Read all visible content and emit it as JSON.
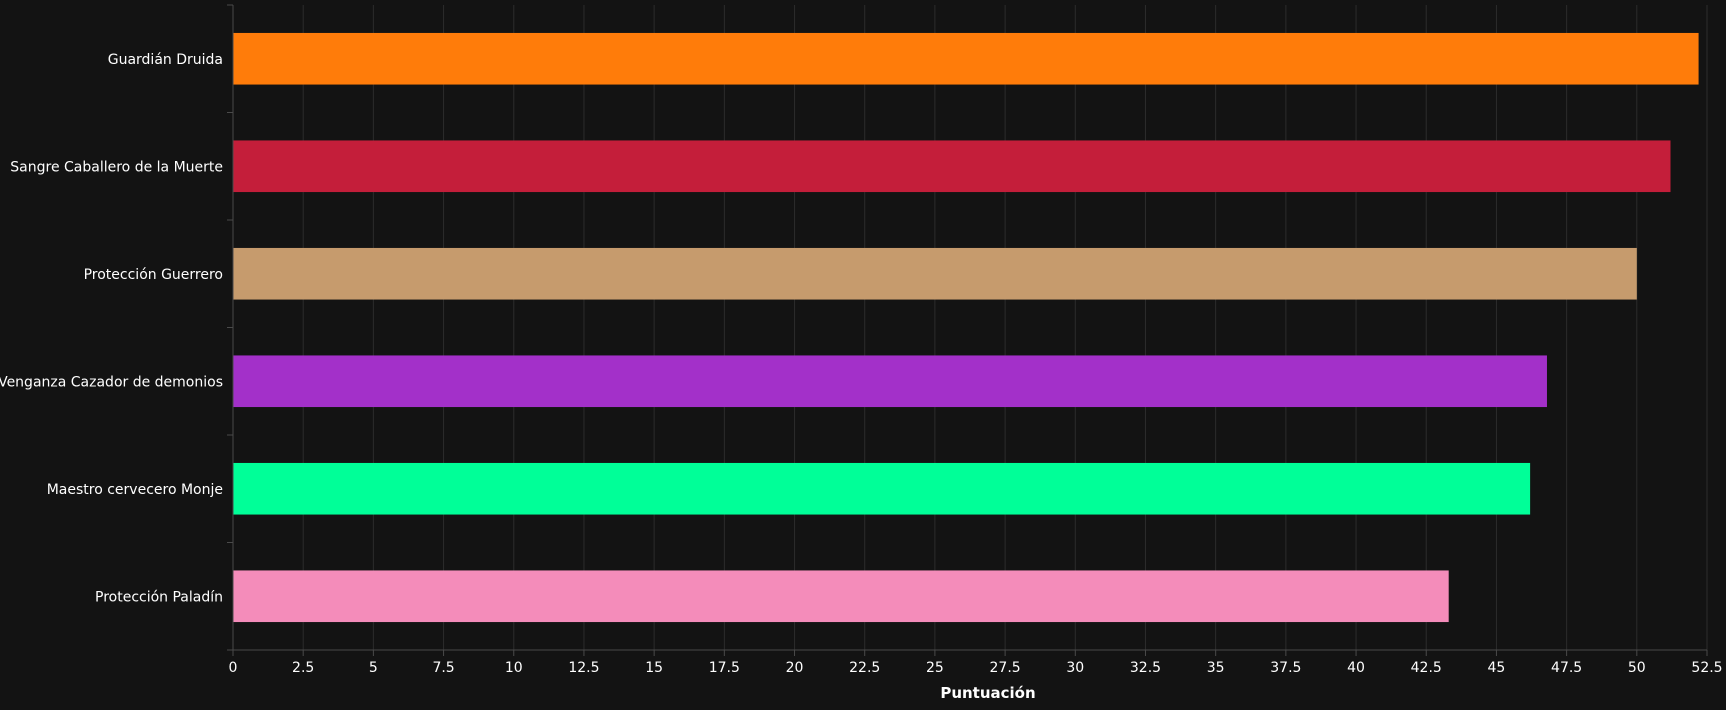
{
  "chart_data": {
    "type": "bar",
    "orientation": "horizontal",
    "categories": [
      "Guardián Druida",
      "Sangre Caballero de la Muerte",
      "Protección Guerrero",
      "Venganza Cazador de demonios",
      "Maestro cervecero Monje",
      "Protección Paladín"
    ],
    "values": [
      52.2,
      51.2,
      50.0,
      46.8,
      46.2,
      43.3
    ],
    "colors": [
      "#ff7c0a",
      "#c41e3a",
      "#c69b6d",
      "#a330c9",
      "#00ff98",
      "#f48cba"
    ],
    "xlabel": "Puntuación",
    "ylabel": "",
    "title": "",
    "xlim": [
      0,
      52.5
    ],
    "xticks": [
      "0",
      "2.5",
      "5",
      "7.5",
      "10",
      "12.5",
      "15",
      "17.5",
      "20",
      "22.5",
      "25",
      "27.5",
      "30",
      "32.5",
      "35",
      "37.5",
      "40",
      "42.5",
      "45",
      "47.5",
      "50",
      "52.5"
    ],
    "grid": true,
    "background": "#131313",
    "grid_color": "#2c2c2c",
    "axis_color": "#4a4a4a"
  }
}
